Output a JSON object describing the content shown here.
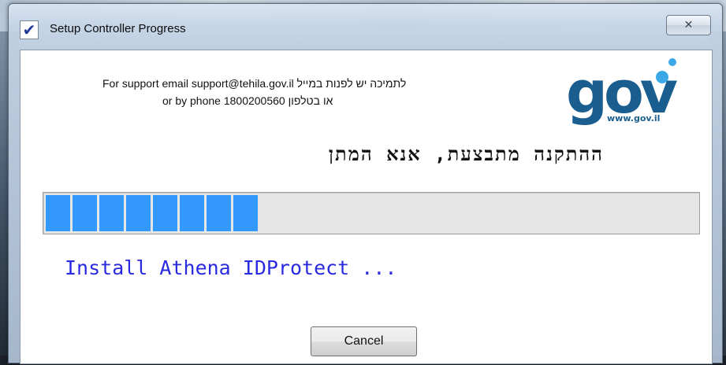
{
  "window": {
    "title": "Setup Controller Progress",
    "title_icon": "checkmark-icon",
    "close_icon": "close-icon",
    "close_glyph": "✕"
  },
  "support": {
    "line1": "For support email support@tehila.gov.il   לתמיכה יש לפנות במייל",
    "line2": "or by phone 1800200560 או בטלפון"
  },
  "logo": {
    "wordmark": "gov",
    "url": "www.gov.il",
    "color": "#1a5e8f",
    "dot_color": "#3aa9e6"
  },
  "headline": "ההתקנה מתבצעת, אנא המתן",
  "progress": {
    "filled_segments": 8,
    "fraction": 0.33,
    "fill_color": "#3399ff"
  },
  "status_text": "Install Athena IDProtect ...",
  "cancel_label": "Cancel"
}
